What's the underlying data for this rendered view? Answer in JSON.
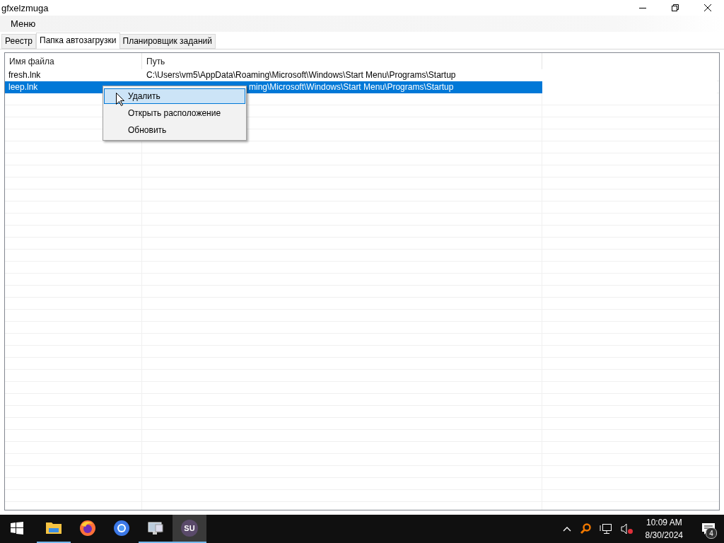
{
  "window": {
    "title": "gfxelzmuga"
  },
  "menu_bar": [
    "Меню"
  ],
  "tabs": [
    {
      "label": "Реестр",
      "selected": false
    },
    {
      "label": "Папка автозагрузки",
      "selected": true
    },
    {
      "label": "Планировщик заданий",
      "selected": false
    }
  ],
  "table": {
    "columns": [
      "Имя файла",
      "Путь"
    ],
    "rows": [
      {
        "name": "fresh.lnk",
        "path": "C:\\Users\\vm5\\AppData\\Roaming\\Microsoft\\Windows\\Start Menu\\Programs\\Startup",
        "selected": false,
        "partly_covered": false
      },
      {
        "name": "leep.lnk",
        "path": "ming\\Microsoft\\Windows\\Start Menu\\Programs\\Startup",
        "selected": true,
        "partly_covered": true
      }
    ]
  },
  "context_menu": [
    {
      "label": "Удалить",
      "selected": true
    },
    {
      "label": "Открыть расположение",
      "selected": false
    },
    {
      "label": "Обновить",
      "selected": false
    }
  ],
  "taskbar": {
    "apps": [
      {
        "kind": "explorer",
        "active": false,
        "open": true
      },
      {
        "kind": "firefox",
        "active": false,
        "open": false
      },
      {
        "kind": "chrome",
        "active": false,
        "open": false
      },
      {
        "kind": "computer",
        "active": false,
        "open": true
      },
      {
        "kind": "su",
        "active": true,
        "open": true,
        "label": "SU"
      }
    ],
    "time": "10:09 AM",
    "date": "8/30/2024",
    "notifications": "4"
  }
}
